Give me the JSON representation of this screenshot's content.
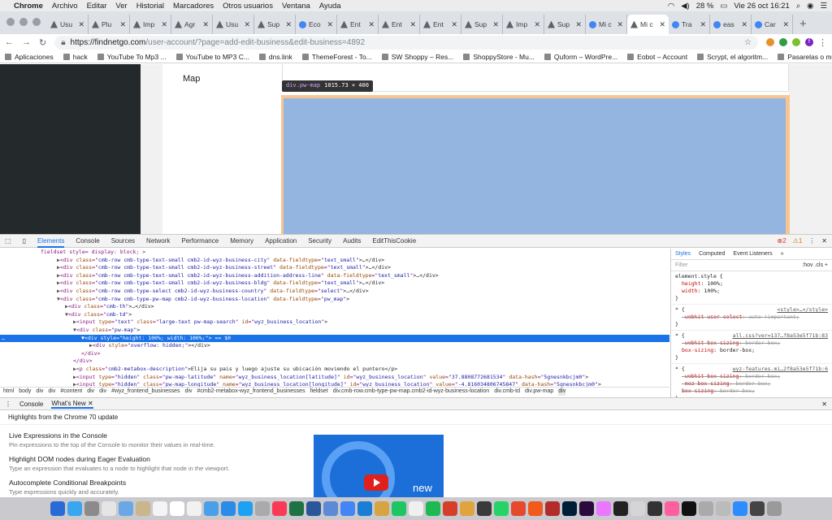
{
  "menubar": {
    "app": "Chrome",
    "items": [
      "Archivo",
      "Editar",
      "Ver",
      "Historial",
      "Marcadores",
      "Otros usuarios",
      "Ventana",
      "Ayuda"
    ],
    "battery": "28 %",
    "datetime": "Vie 26 oct  16:21"
  },
  "tabs": [
    {
      "label": "Usu",
      "fav": "tri"
    },
    {
      "label": "Plu",
      "fav": "tri"
    },
    {
      "label": "Imp",
      "fav": "tri"
    },
    {
      "label": "Agr",
      "fav": "tri"
    },
    {
      "label": "Usu",
      "fav": "tri"
    },
    {
      "label": "Sup",
      "fav": "tri"
    },
    {
      "label": "Eco",
      "fav": "circle"
    },
    {
      "label": "Ent",
      "fav": "tri"
    },
    {
      "label": "Ent",
      "fav": "tri"
    },
    {
      "label": "Ent",
      "fav": "tri"
    },
    {
      "label": "Sup",
      "fav": "tri"
    },
    {
      "label": "Imp",
      "fav": "tri"
    },
    {
      "label": "Sup",
      "fav": "tri"
    },
    {
      "label": "Mi c",
      "fav": "circle"
    },
    {
      "label": "Mi c",
      "fav": "tri",
      "active": true
    },
    {
      "label": "Tra",
      "fav": "circle"
    },
    {
      "label": "eas",
      "fav": "circle"
    },
    {
      "label": "Car",
      "fav": "circle"
    }
  ],
  "address": {
    "host": "https://findnetgo.com",
    "path": "/user-account/?page=add-edit-business&edit-business=4892"
  },
  "profile_initial": "f",
  "bookmarks": [
    "Aplicaciones",
    "hack",
    "YouTube To Mp3 ...",
    "YouTube to MP3 C...",
    "dns.link",
    "ThemeForest - To...",
    "SW Shoppy – Res...",
    "ShoppyStore - Mu...",
    "Quform – WordPre...",
    "Eobot – Account",
    "Scrypt, el algoritm...",
    "Pasarelas o metod..."
  ],
  "page": {
    "map_label": "Map",
    "tooltip_tag": "div.pw-map",
    "tooltip_size": "1015.73 × 400"
  },
  "devtools": {
    "tabs": [
      "Elements",
      "Console",
      "Sources",
      "Network",
      "Performance",
      "Memory",
      "Application",
      "Security",
      "Audits",
      "EditThisCookie"
    ],
    "errors": "2",
    "warnings": "1",
    "dom_lines": [
      {
        "indent": 10,
        "text": "fieldset style= display: block; >",
        "kind": "plain"
      },
      {
        "indent": 14,
        "tag": "div",
        "attrs": [
          [
            "class",
            "cmb-row cmb-type-text-small cmb2-id-wyz-business-city"
          ],
          [
            "data-fieldtype",
            "text_small"
          ]
        ],
        "tail": ">…</div>"
      },
      {
        "indent": 14,
        "tag": "div",
        "attrs": [
          [
            "class",
            "cmb-row cmb-type-text-small cmb2-id-wyz-business-street"
          ],
          [
            "data-fieldtype",
            "text_small"
          ]
        ],
        "tail": ">…</div>"
      },
      {
        "indent": 14,
        "tag": "div",
        "attrs": [
          [
            "class",
            "cmb-row cmb-type-text-small cmb2-id-wyz-business-addition-address-line"
          ],
          [
            "data-fieldtype",
            "text_small"
          ]
        ],
        "tail": ">…</div>"
      },
      {
        "indent": 14,
        "tag": "div",
        "attrs": [
          [
            "class",
            "cmb-row cmb-type-text-small cmb2-id-wyz-business-bldg"
          ],
          [
            "data-fieldtype",
            "text_small"
          ]
        ],
        "tail": ">…</div>"
      },
      {
        "indent": 14,
        "tag": "div",
        "attrs": [
          [
            "class",
            "cmb-row cmb-type-select cmb2-id-wyz-business-country"
          ],
          [
            "data-fieldtype",
            "select"
          ]
        ],
        "tail": ">…</div>"
      },
      {
        "indent": 14,
        "tag": "div",
        "attrs": [
          [
            "class",
            "cmb-row cmb-type-pw-map cmb2-id-wyz-business-location"
          ],
          [
            "data-fieldtype",
            "pw_map"
          ]
        ],
        "tail": ">",
        "open": true
      },
      {
        "indent": 16,
        "tag": "div",
        "attrs": [
          [
            "class",
            "cmb-th"
          ]
        ],
        "tail": ">…</div>"
      },
      {
        "indent": 16,
        "tag": "div",
        "attrs": [
          [
            "class",
            "cmb-td"
          ]
        ],
        "tail": ">",
        "open": true
      },
      {
        "indent": 18,
        "tag": "input",
        "attrs": [
          [
            "type",
            "text"
          ],
          [
            "class",
            "large-text pw-map-search"
          ],
          [
            "id",
            "wyz_business_location"
          ]
        ],
        "tail": ">"
      },
      {
        "indent": 18,
        "tag": "div",
        "attrs": [
          [
            "class",
            "pw-map"
          ]
        ],
        "tail": ">",
        "open": true
      },
      {
        "indent": 20,
        "tag": "div",
        "attrs": [
          [
            "style",
            "height: 100%; width: 100%;"
          ]
        ],
        "tail": "> == $0",
        "open": true,
        "selected": true
      },
      {
        "indent": 22,
        "tag": "div",
        "attrs": [
          [
            "style",
            "overflow: hidden;"
          ]
        ],
        "tail": "></div>"
      },
      {
        "indent": 20,
        "text": "</div>",
        "kind": "plain"
      },
      {
        "indent": 18,
        "text": "</div>",
        "kind": "plain"
      },
      {
        "indent": 18,
        "tag": "p",
        "attrs": [
          [
            "class",
            "cmb2-metabox-description"
          ]
        ],
        "tail": ">Elija su pais y luego ajuste su ubicación moviendo el puntero</p>"
      },
      {
        "indent": 18,
        "tag": "input",
        "attrs": [
          [
            "type",
            "hidden"
          ],
          [
            "class",
            "pw-map-latitude"
          ],
          [
            "name",
            "wyz_business_location[latitude]"
          ],
          [
            "id",
            "wyz_business_location"
          ],
          [
            "value",
            "37.8808772681534"
          ],
          [
            "data-hash",
            "5gnesnkbcjm0"
          ]
        ],
        "tail": ">"
      },
      {
        "indent": 18,
        "tag": "input",
        "attrs": [
          [
            "type",
            "hidden"
          ],
          [
            "class",
            "pw-map-longitude"
          ],
          [
            "name",
            "wyz_business_location[longitude]"
          ],
          [
            "id",
            "wyz_business_location"
          ],
          [
            "value",
            "-4.816034806745847"
          ],
          [
            "data-hash",
            "5gnesnkbcjm0"
          ]
        ],
        "tail": ">"
      }
    ],
    "breadcrumbs": [
      "html",
      "body",
      "div",
      "div",
      "#content",
      "div",
      "div",
      "#wyz_frontend_businesses",
      "div",
      "#cmb2-metabox-wyz_frontend_businesses",
      "fieldset",
      "div.cmb-row.cmb-type-pw-map.cmb2-id-wyz-business-location",
      "div.cmb-td",
      "div.pw-map",
      "div"
    ],
    "styles_tabs": [
      "Styles",
      "Computed",
      "Event Listeners"
    ],
    "filter_placeholder": "Filter",
    "filter_toggles": ":hov  .cls  +",
    "rules": [
      {
        "selector": "element.style {",
        "props": [
          [
            "height",
            "100%",
            false
          ],
          [
            "width",
            "100%",
            false
          ]
        ],
        "src": ""
      },
      {
        "selector": "* {",
        "props": [
          [
            "-webkit-user-select",
            "auto !important",
            true
          ]
        ],
        "src": "<style>…</style>"
      },
      {
        "selector": "* {",
        "props": [
          [
            "-webkit-box-sizing",
            "border-box",
            true
          ],
          [
            "box-sizing",
            "border-box",
            false
          ]
        ],
        "src": "all.css?ver=137…f8a53e5f71b:83"
      },
      {
        "selector": "* {",
        "props": [
          [
            "-webkit-box-sizing",
            "border-box",
            true
          ],
          [
            "-moz-box-sizing",
            "border-box",
            true
          ],
          [
            "box-sizing",
            "border-box",
            true
          ]
        ],
        "src": "wyz-features.mi…2f8a53e5f71b:6"
      }
    ]
  },
  "drawer": {
    "tabs": [
      "Console",
      "What's New"
    ],
    "header": "Highlights from the Chrome 70 update",
    "items": [
      {
        "title": "Live Expressions in the Console",
        "desc": "Pin expressions to the top of the Console to monitor their values in real-time."
      },
      {
        "title": "Highlight DOM nodes during Eager Evaluation",
        "desc": "Type an expression that evaluates to a node to highlight that node in the viewport."
      },
      {
        "title": "Autocomplete Conditional Breakpoints",
        "desc": "Type expressions quickly and accurately."
      }
    ],
    "video_text": "new"
  },
  "dock_colors": [
    "#2a6ad6",
    "#3aa5f1",
    "#8b8b8b",
    "#e5e5e5",
    "#6aa8e5",
    "#c9b68a",
    "#f4f4f4",
    "#ffffff",
    "#f1f1f1",
    "#4aa0e8",
    "#2b8be8",
    "#1da1f2",
    "#aaaaaa",
    "#fb3b56",
    "#1f7244",
    "#2b579a",
    "#5d8ad7",
    "#4285f4",
    "#1a7fd4",
    "#d6a441",
    "#1ec663",
    "#f0f0f0",
    "#1db954",
    "#d53f2a",
    "#e1a33e",
    "#3a3a3a",
    "#25d366",
    "#e54a2f",
    "#f25a1c",
    "#b32c2c",
    "#001e36",
    "#2b0a3d",
    "#ea77ff",
    "#222222",
    "#d5d5d5",
    "#333333",
    "#ff5f9e",
    "#111111",
    "#aaaaaa",
    "#bbbbbb",
    "#2d8cff",
    "#444444",
    "#9a9a9a"
  ]
}
